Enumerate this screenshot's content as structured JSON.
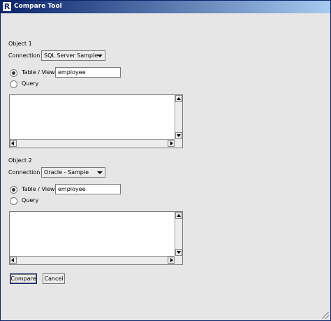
{
  "window": {
    "title": "Compare Tool",
    "icon": "R"
  },
  "object1": {
    "heading": "Object 1",
    "connection_label": "Connection",
    "connection_value": "SQL Server Sample",
    "table_view_label": "Table / View",
    "table_view_value": "employee",
    "query_label": "Query",
    "mode_selected": "table_view"
  },
  "object2": {
    "heading": "Object 2",
    "connection_label": "Connection",
    "connection_value": "Oracle - Sample",
    "table_view_label": "Table / View",
    "table_view_value": "employee",
    "query_label": "Query",
    "mode_selected": "table_view"
  },
  "buttons": {
    "compare": "Compare",
    "cancel": "Cancel"
  }
}
